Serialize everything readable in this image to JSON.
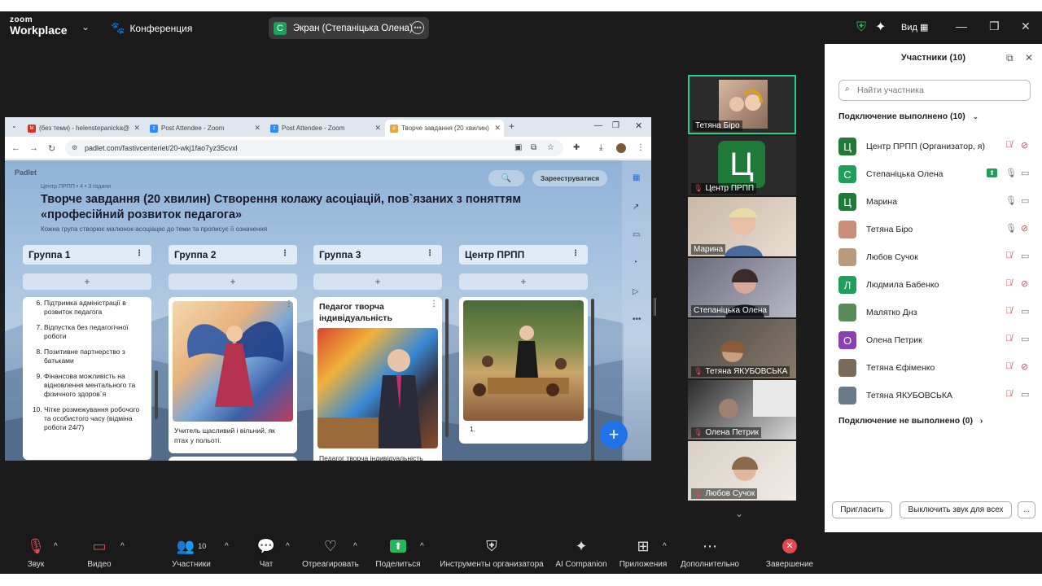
{
  "titlebar": {
    "logo_line1": "zoom",
    "logo_line2": "Workplace",
    "meeting_label": "Конференция",
    "screen_share_label": "Экран (Степаніцька Олена)",
    "screen_share_badge": "С",
    "view_label": "Вид"
  },
  "browser": {
    "tabs": [
      {
        "label": "(без теми) - helenstepanicka@",
        "icon": "gmail-icon"
      },
      {
        "label": "Post Attendee - Zoom",
        "icon": "zoom-icon"
      },
      {
        "label": "Post Attendee - Zoom",
        "icon": "zoom-icon"
      },
      {
        "label": "Творче завдання (20 хвилин)",
        "icon": "padlet-icon"
      }
    ],
    "url": "padlet.com/fastivcenteriet/20-wkj1fao7yz35cvxl"
  },
  "padlet": {
    "brand": "Padlet",
    "meta": "Центр ПРПП • 4 • 3 години",
    "title": "Творче завдання (20 хвилин) Створення  колажу асоціацій, пов`язаних з поняттям «професійний розвиток педагога»",
    "description": "Кожна група створює малюнок-асоціацію до теми та прописує її означення",
    "signup_label": "Зарееструватися",
    "columns": [
      {
        "header": "Группа 1"
      },
      {
        "header": "Группа 2"
      },
      {
        "header": "Группа 3"
      },
      {
        "header": "Центр ПРПП"
      }
    ],
    "add_symbol": "+",
    "group1_list": {
      "start": 6,
      "items": [
        "Підтримка адміністрації в розвиток педагога",
        "Відпустка без педагогічної роботи",
        "Позитивне партнерство з батьками",
        "Фінансова можливість на відновлення ментального та фізичного здоров`я",
        "Чітке розмежування робочого та особистого часу (відміна роботи 24/7)"
      ]
    },
    "group2_caption": "Учитель щасливий і вільний, як птах у польоті.",
    "group3_title": "Педагог творча індивідуальність",
    "group3_caption": "Педагог творча індивідуальність",
    "center_caption": "1."
  },
  "video_tiles": [
    {
      "name": "Тетяна Біро",
      "muted": false,
      "active": true
    },
    {
      "name": "Центр ПРПП",
      "muted": true,
      "avatar": "Ц"
    },
    {
      "name": "Марина",
      "muted": false
    },
    {
      "name": "Степаніцька Олена",
      "muted": false
    },
    {
      "name": "Тетяна ЯКУБОВСЬКА",
      "muted": true
    },
    {
      "name": "Олена Петрик",
      "muted": true
    },
    {
      "name": "Любов Сучок",
      "muted": true
    }
  ],
  "panel": {
    "title": "Участники (10)",
    "search_placeholder": "Найти участника",
    "connected_header": "Подключение выполнено (10)",
    "not_connected_header": "Подключение не выполнено (0)",
    "participants": [
      {
        "name": "Центр ПРПП (Организатор, я)",
        "avatar": "Ц",
        "color": "#1f7a3a",
        "mic": "off",
        "video": "off"
      },
      {
        "name": "Степаніцька Олена",
        "avatar": "С",
        "color": "#1fa05a",
        "mic": "on",
        "video": "on",
        "sharing": true
      },
      {
        "name": "Марина",
        "avatar": "Ц",
        "color": "#1f7a3a",
        "mic": "on",
        "video": "on"
      },
      {
        "name": "Тетяна Біро",
        "avatar": "",
        "color": "#c98f7a",
        "mic": "on",
        "video": "off"
      },
      {
        "name": "Любов Сучок",
        "avatar": "",
        "color": "#b99a7a",
        "mic": "off",
        "video": "on"
      },
      {
        "name": "Людмила Бабенко",
        "avatar": "Л",
        "color": "#1fa05a",
        "mic": "off",
        "video": "off"
      },
      {
        "name": "Малятко Днз",
        "avatar": "",
        "color": "#5a8a5a",
        "mic": "off",
        "video": "on"
      },
      {
        "name": "Олена Петрик",
        "avatar": "О",
        "color": "#8a3fb5",
        "mic": "off",
        "video": "on"
      },
      {
        "name": "Тетяна Єфіменко",
        "avatar": "",
        "color": "#7a6a5a",
        "mic": "off",
        "video": "off"
      },
      {
        "name": "Тетяна ЯКУБОВСЬКА",
        "avatar": "",
        "color": "#6a7a8a",
        "mic": "off",
        "video": "on"
      }
    ],
    "invite_label": "Пригласить",
    "mute_all_label": "Выключить звук для всех",
    "more_label": "..."
  },
  "toolbar": {
    "audio_label": "Звук",
    "video_label": "Видео",
    "participants_label": "Участники",
    "participants_count": "10",
    "chat_label": "Чат",
    "react_label": "Отреагировать",
    "share_label": "Поделиться",
    "host_tools_label": "Инструменты организатора",
    "ai_label": "AI Companion",
    "apps_label": "Приложения",
    "more_label": "Дополнительно",
    "end_label": "Завершение"
  },
  "colors": {
    "accent_green": "#23d18b",
    "mute_red": "#e5484d",
    "padlet_fab": "#1e73e8"
  }
}
